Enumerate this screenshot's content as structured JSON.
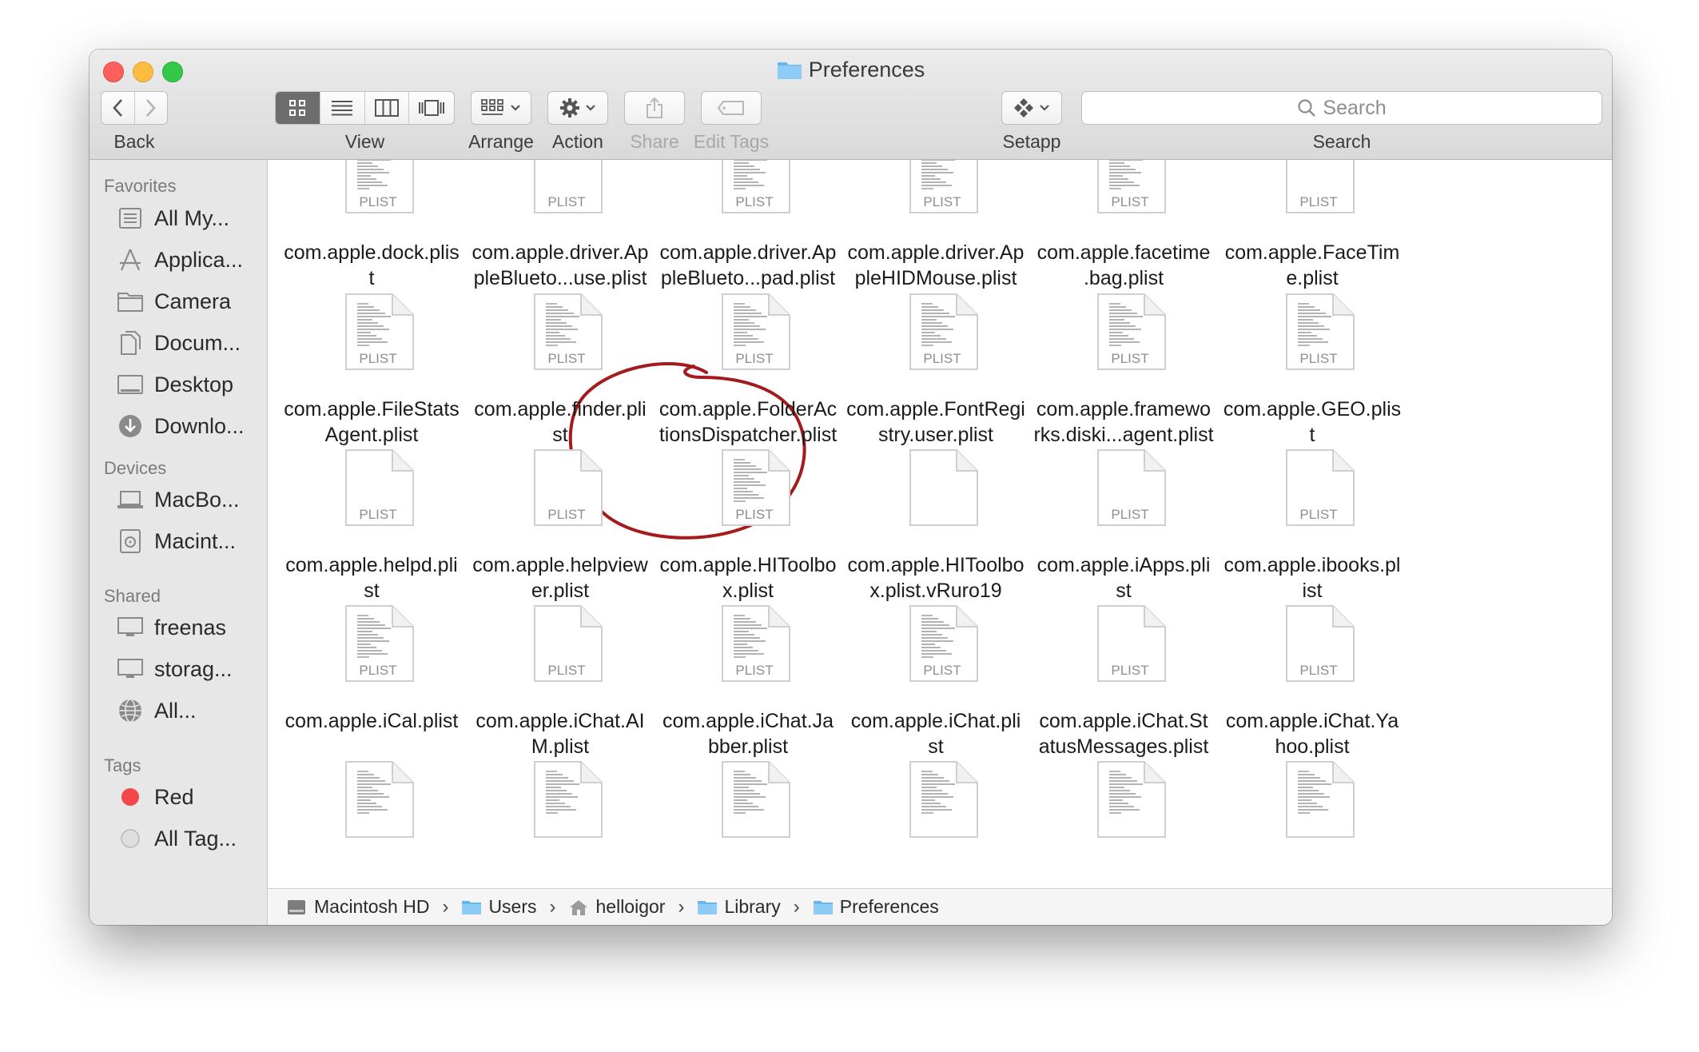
{
  "window": {
    "title": "Preferences"
  },
  "toolbar": {
    "back_label": "Back",
    "view_label": "View",
    "arrange_label": "Arrange",
    "action_label": "Action",
    "share_label": "Share",
    "edit_tags_label": "Edit Tags",
    "setapp_label": "Setapp",
    "search_label": "Search",
    "search_placeholder": "Search",
    "active_view": "icon-view"
  },
  "sidebar": {
    "favorites_header": "Favorites",
    "favorites": [
      {
        "label": "All My...",
        "icon": "all-my-files-icon"
      },
      {
        "label": "Applica...",
        "icon": "applications-icon"
      },
      {
        "label": "Camera",
        "icon": "folder-icon"
      },
      {
        "label": "Docum...",
        "icon": "documents-icon"
      },
      {
        "label": "Desktop",
        "icon": "desktop-icon"
      },
      {
        "label": "Downlo...",
        "icon": "downloads-icon"
      }
    ],
    "devices_header": "Devices",
    "devices": [
      {
        "label": "MacBo...",
        "icon": "laptop-icon"
      },
      {
        "label": "Macint...",
        "icon": "hard-disk-icon"
      }
    ],
    "shared_header": "Shared",
    "shared": [
      {
        "label": "freenas",
        "icon": "monitor-icon"
      },
      {
        "label": "storag...",
        "icon": "monitor-icon"
      },
      {
        "label": "All...",
        "icon": "network-icon"
      }
    ],
    "tags_header": "Tags",
    "tags": [
      {
        "label": "Red",
        "color": "#f4474b"
      },
      {
        "label": "All Tag...",
        "color": "#d8d8d8"
      }
    ]
  },
  "files": {
    "type_label": "PLIST",
    "rows": [
      [
        {
          "line1": "com.apple.dock.plis",
          "line2": "t",
          "doc": "text"
        },
        {
          "line1": "com.apple.driver.Ap",
          "line2": "pleBlueto...use.plist",
          "doc": "blank"
        },
        {
          "line1": "com.apple.driver.Ap",
          "line2": "pleBlueto...pad.plist",
          "doc": "text"
        },
        {
          "line1": "com.apple.driver.Ap",
          "line2": "pleHIDMouse.plist",
          "doc": "text"
        },
        {
          "line1": "com.apple.facetime",
          "line2": ".bag.plist",
          "doc": "text"
        },
        {
          "line1": "com.apple.FaceTim",
          "line2": "e.plist",
          "doc": "blank"
        }
      ],
      [
        {
          "line1": "com.apple.FileStats",
          "line2": "Agent.plist",
          "doc": "text"
        },
        {
          "line1": "com.apple.finder.pli",
          "line2": "st",
          "doc": "text"
        },
        {
          "line1": "com.apple.FolderAc",
          "line2": "tionsDispatcher.plist",
          "doc": "text"
        },
        {
          "line1": "com.apple.FontRegi",
          "line2": "stry.user.plist",
          "doc": "text"
        },
        {
          "line1": "com.apple.framewo",
          "line2": "rks.diski...agent.plist",
          "doc": "text"
        },
        {
          "line1": "com.apple.GEO.plis",
          "line2": "t",
          "doc": "text"
        }
      ],
      [
        {
          "line1": "com.apple.helpd.pli",
          "line2": "st",
          "doc": "blank"
        },
        {
          "line1": "com.apple.helpview",
          "line2": "er.plist",
          "doc": "blank"
        },
        {
          "line1": "com.apple.HIToolbo",
          "line2": "x.plist",
          "doc": "text"
        },
        {
          "line1": "com.apple.HIToolbo",
          "line2": "x.plist.vRuro19",
          "doc": "plain"
        },
        {
          "line1": "com.apple.iApps.pli",
          "line2": "st",
          "doc": "blank"
        },
        {
          "line1": "com.apple.ibooks.pl",
          "line2": "ist",
          "doc": "blank"
        }
      ],
      [
        {
          "line1": "com.apple.iCal.plist",
          "line2": "",
          "doc": "text"
        },
        {
          "line1": "com.apple.iChat.AI",
          "line2": "M.plist",
          "doc": "blank"
        },
        {
          "line1": "com.apple.iChat.Ja",
          "line2": "bber.plist",
          "doc": "text"
        },
        {
          "line1": "com.apple.iChat.pli",
          "line2": "st",
          "doc": "text"
        },
        {
          "line1": "com.apple.iChat.St",
          "line2": "atusMessages.plist",
          "doc": "blank"
        },
        {
          "line1": "com.apple.iChat.Ya",
          "line2": "hoo.plist",
          "doc": "blank"
        }
      ]
    ],
    "partial_row_count": 6,
    "highlight": {
      "row": 1,
      "col": 1,
      "color": "#a31b1b"
    }
  },
  "pathbar": {
    "crumbs": [
      {
        "label": "Macintosh HD",
        "icon": "hard-disk-icon"
      },
      {
        "label": "Users",
        "icon": "folder-icon"
      },
      {
        "label": "helloigor",
        "icon": "home-icon"
      },
      {
        "label": "Library",
        "icon": "folder-icon"
      },
      {
        "label": "Preferences",
        "icon": "folder-icon"
      }
    ],
    "separator": "›"
  },
  "colors": {
    "folder_blue": "#68b6ef",
    "annotation_red": "#a31b1b",
    "selected_segment": "#6d6d6d"
  }
}
